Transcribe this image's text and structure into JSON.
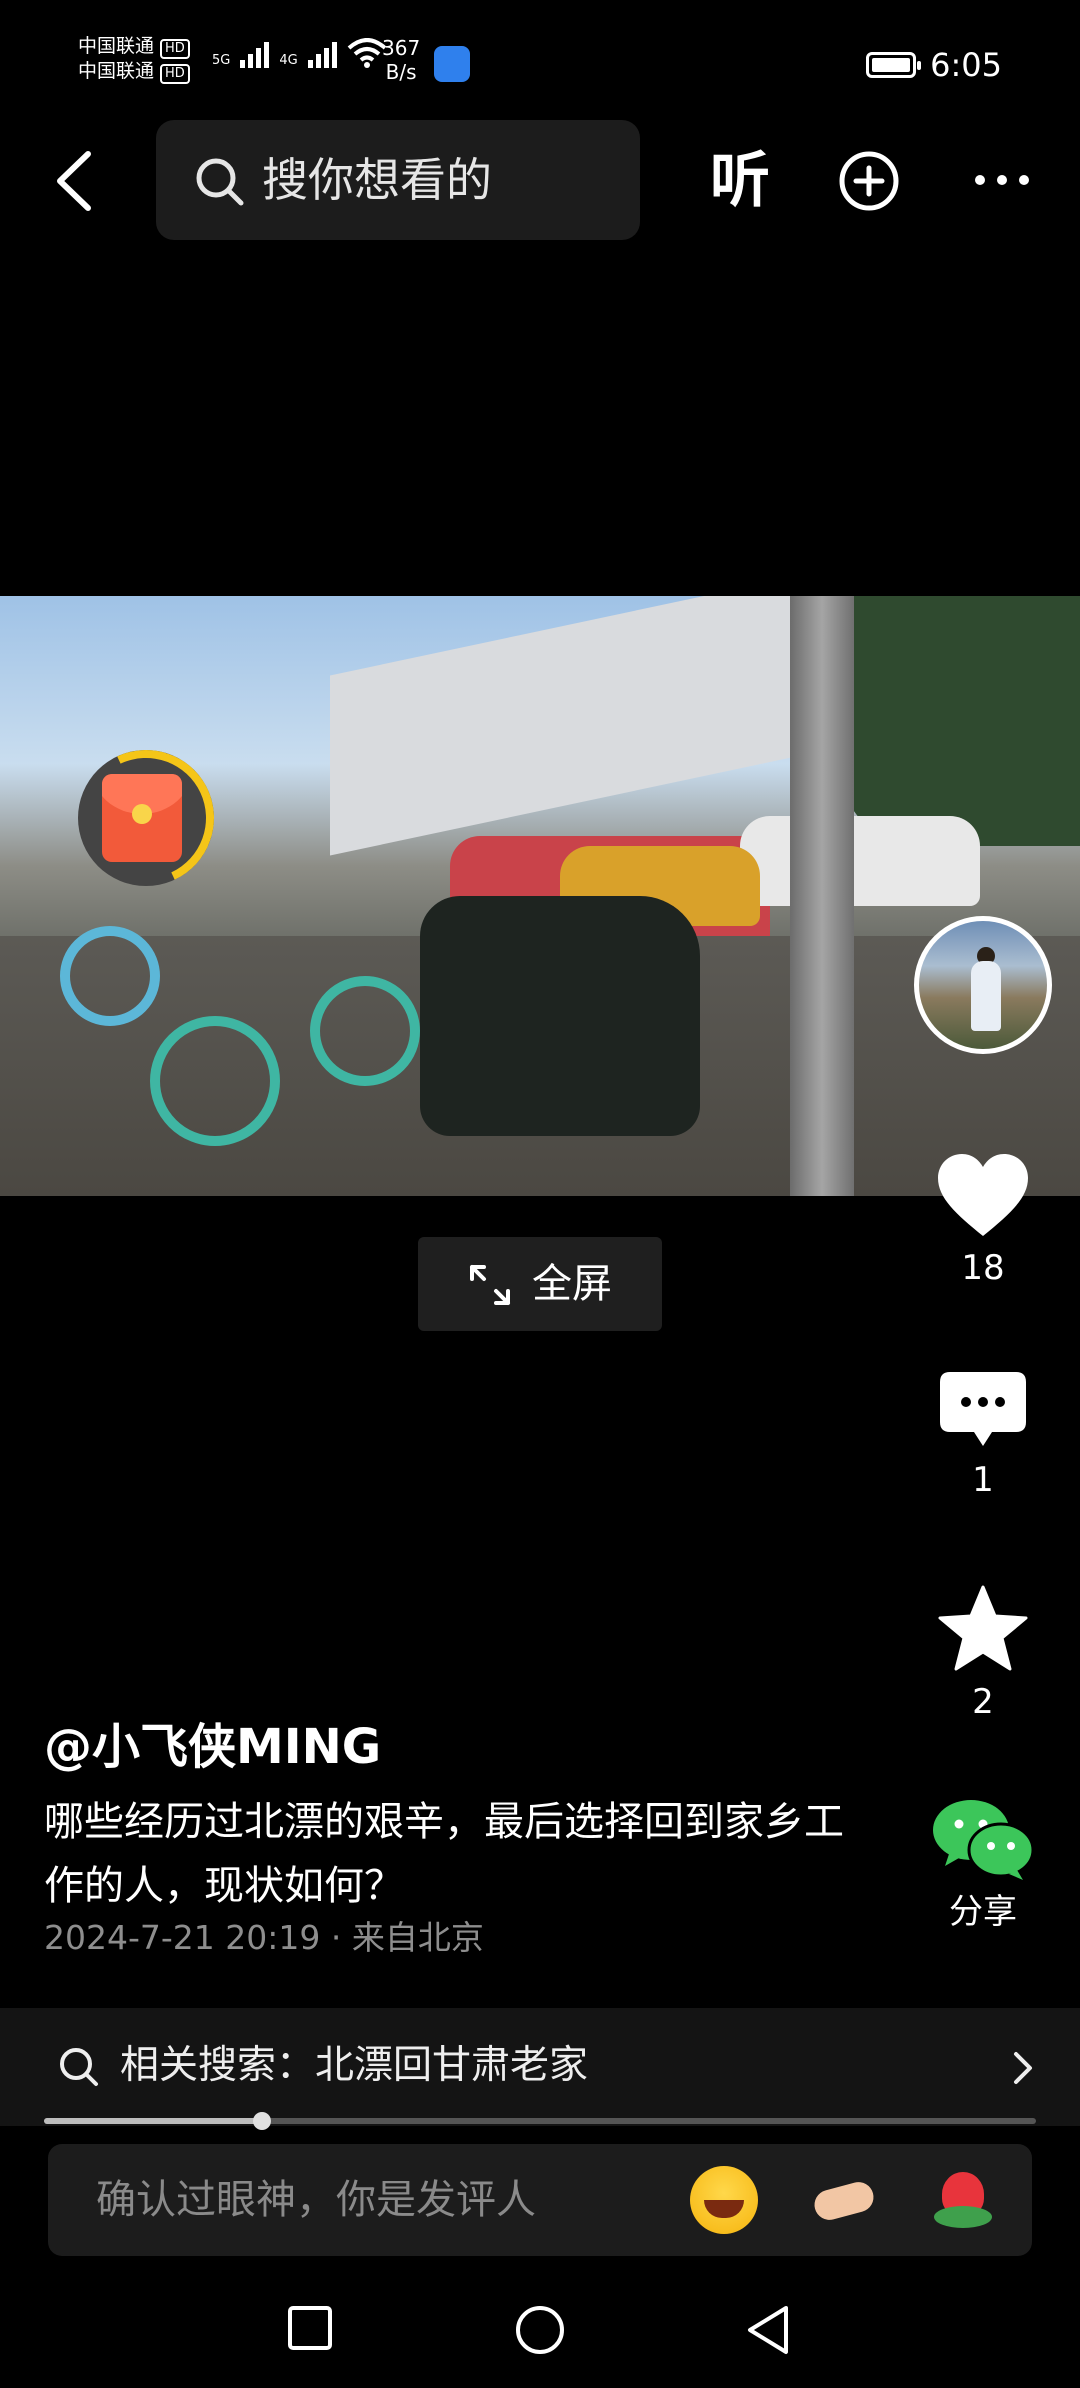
{
  "status_bar": {
    "carrier_1": "中国联通",
    "carrier_2": "中国联通",
    "hd_badge": "HD",
    "sim1_network": "5G",
    "sim2_network": "4G",
    "net_speed_value": "367",
    "net_speed_unit": "B/s",
    "time": "6:05"
  },
  "top_bar": {
    "search_placeholder": "搜你想看的",
    "listen_label": "听"
  },
  "video": {
    "fullscreen_label": "全屏"
  },
  "actions": {
    "like_count": "18",
    "comment_count": "1",
    "favorite_count": "2",
    "share_label": "分享"
  },
  "post": {
    "author": "@小飞侠MING",
    "description": "哪些经历过北漂的艰辛，最后选择回到家乡工作的人，现状如何？",
    "meta": "2024-7-21 20:19 · 来自北京"
  },
  "related_search": {
    "text": "相关搜索：北漂回甘肃老家"
  },
  "playback": {
    "progress": 0.22
  },
  "comment_input": {
    "placeholder": "确认过眼神，你是发评人"
  },
  "icons": {
    "back": "back-arrow-icon",
    "search": "search-icon",
    "add": "plus-circle-icon",
    "more": "more-dots-icon",
    "like": "heart-icon",
    "comment": "comment-bubble-icon",
    "favorite": "star-icon",
    "share": "wechat-icon"
  },
  "colors": {
    "background": "#000000",
    "share_green": "#3cc65a",
    "red_packet": "#f25a3a",
    "timer_ring": "#f5c518"
  }
}
